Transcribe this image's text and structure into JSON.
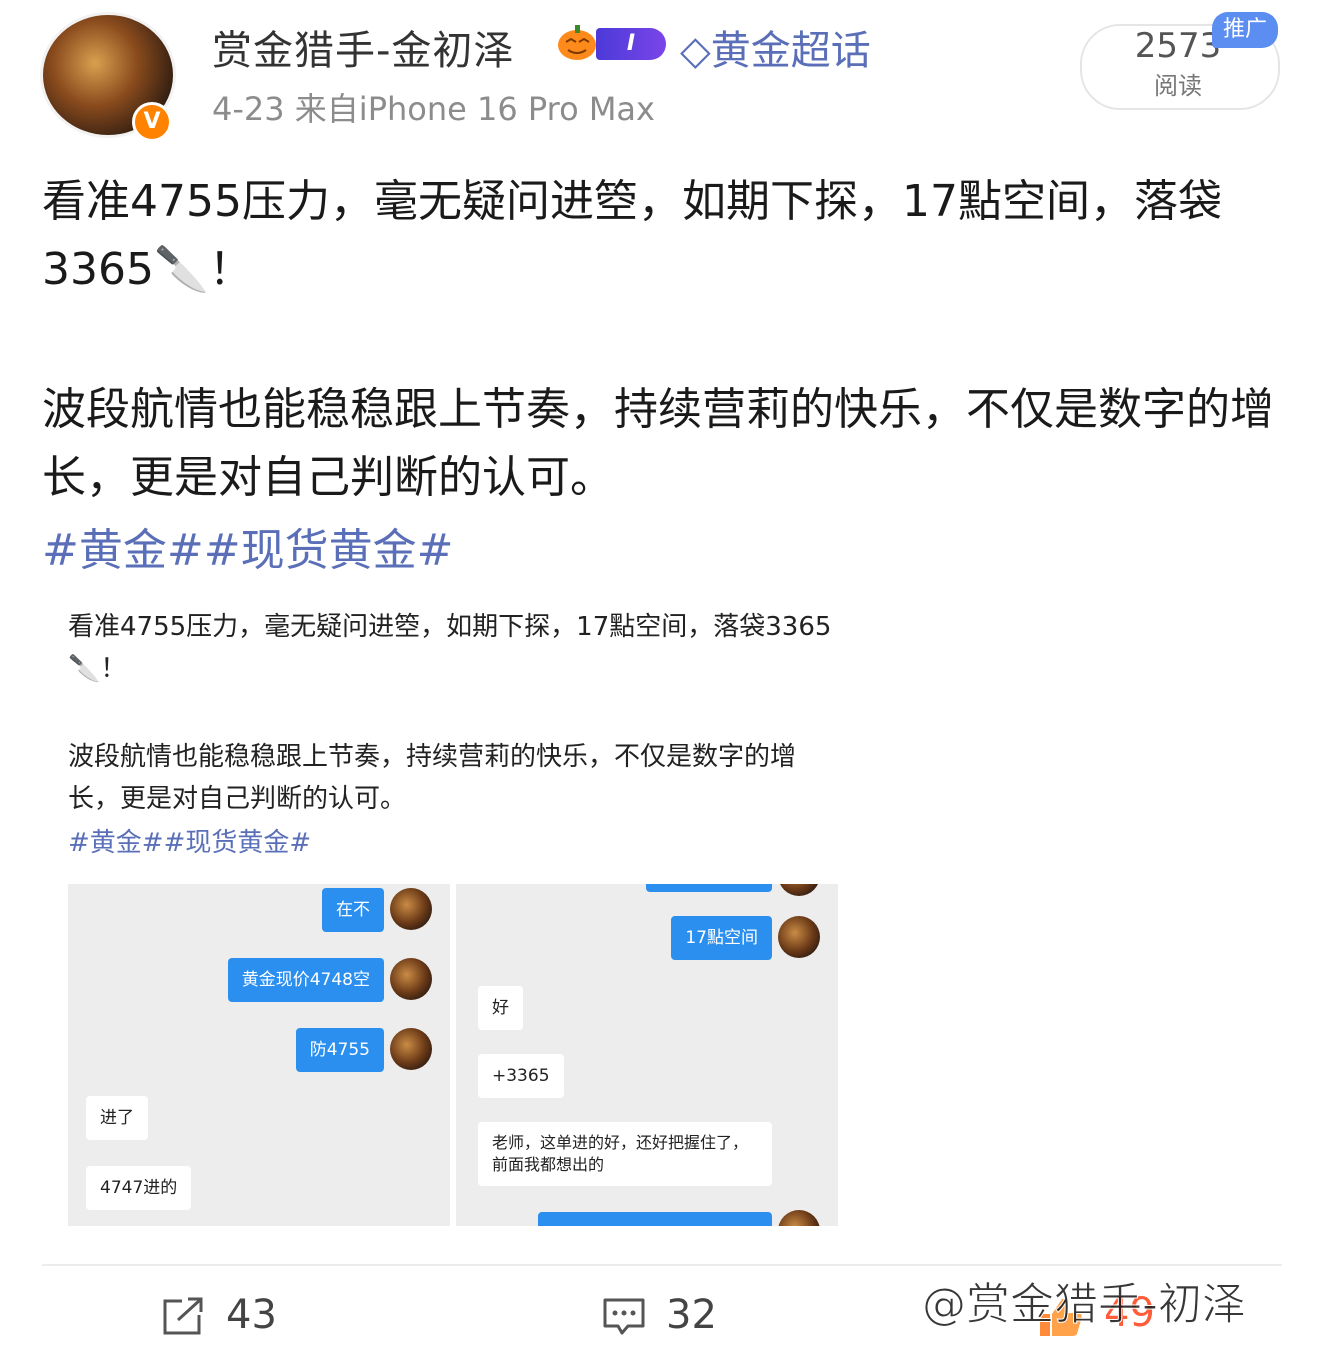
{
  "header": {
    "username": "赏金猎手-金初泽",
    "level_badge": "I",
    "super_topic": "◇黄金超话",
    "meta": "4-23  来自iPhone 16 Pro Max",
    "verified_badge": "V",
    "read_count": "2573",
    "read_label": "阅读",
    "promo_label": "推广",
    "accent_color": "#ff8200",
    "link_color": "#5a6fb8"
  },
  "post": {
    "para1": "看准4755压力，毫无疑问进箜，如期下探，17點空间，落袋3365🔪！",
    "para2": "波段航情也能稳稳跟上节奏，持续营莉的快乐，不仅是数字的增长，更是对自己判断的认可。",
    "tags": "#黄金##现货黄金#"
  },
  "screenshot": {
    "para1": "看准4755压力，毫无疑问进箜，如期下探，17點空间，落袋3365🔪！",
    "para2": "波段航情也能稳稳跟上节奏，持续营莉的快乐，不仅是数字的增长，更是对自己判断的认可。",
    "tags": "#黄金##现货黄金#",
    "chat_left": {
      "out1": "在不",
      "out2": "黄金现价4748空",
      "out3": "防4755",
      "in1": "进了",
      "in2": "4747进的"
    },
    "chat_right": {
      "out1": "17點空间",
      "in1": "好",
      "in2": "+3365",
      "in3": "老师，这单进的好，还好把握住了，前面我都想出的"
    }
  },
  "footer": {
    "share_count": "43",
    "comment_count": "32",
    "like_count": "49",
    "watermark": "@赏金猎手-初泽"
  }
}
